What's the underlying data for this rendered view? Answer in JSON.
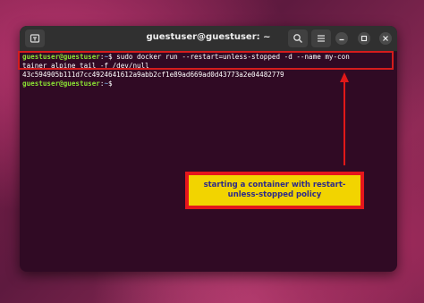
{
  "window": {
    "title": "guestuser@guestuser: ~"
  },
  "terminal": {
    "lines": [
      {
        "user": "guestuser@guestuser",
        "sep": ":",
        "path": "~",
        "prompt": "$",
        "cmd": " sudo docker run --restart=unless-stopped -d --name my-con"
      },
      {
        "text": "tainer alpine tail -f /dev/null"
      },
      {
        "text": "43c594905b111d7cc4924641612a9abb2cf1e89ad669ad0d43773a2e04482779"
      },
      {
        "user": "guestuser@guestuser",
        "sep": ":",
        "path": "~",
        "prompt": "$",
        "cmd": " "
      }
    ]
  },
  "annotation": {
    "callout_text": "starting a container with restart-unless-stopped policy",
    "box_color": "#d41c1c",
    "callout_bg": "#f2d400",
    "callout_text_color": "#2d2a8a"
  },
  "colors": {
    "terminal_bg": "#300a24",
    "user_green": "#8ae234",
    "path_blue": "#729fcf"
  }
}
